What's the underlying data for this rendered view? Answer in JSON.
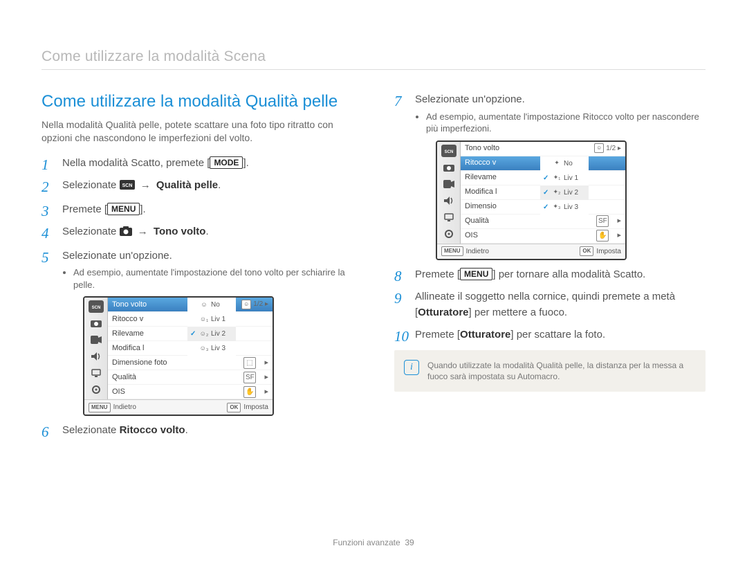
{
  "header": "Come utilizzare la modalità Scena",
  "section_title": "Come utilizzare la modalità Qualità pelle",
  "intro": "Nella modalità Qualità pelle, potete scattare una foto tipo ritratto con opzioni che nascondono le imperfezioni del volto.",
  "steps_left": {
    "s1_pre": "Nella modalità Scatto, premete [",
    "s1_btn": "MODE",
    "s1_post": "].",
    "s2_pre": "Selezionate ",
    "s2_bold": "Qualità pelle",
    "s2_post": ".",
    "s3_pre": "Premete [",
    "s3_btn": "MENU",
    "s3_post": "].",
    "s4_pre": "Selezionate ",
    "s4_bold": "Tono volto",
    "s4_post": ".",
    "s5": "Selezionate un'opzione.",
    "s5_sub": "Ad esempio, aumentate l'impostazione del tono volto per schiarire la pelle.",
    "s6_pre": "Selezionate ",
    "s6_bold": "Ritocco volto",
    "s6_post": "."
  },
  "steps_right": {
    "s7": "Selezionate un'opzione.",
    "s7_sub": "Ad esempio, aumentate l'impostazione Ritocco volto per nascondere più imperfezioni.",
    "s8_pre": "Premete [",
    "s8_btn": "MENU",
    "s8_post": "] per tornare alla modalità Scatto.",
    "s9_pre": "Allineate il soggetto nella cornice, quindi premete a metà [",
    "s9_bold": "Otturatore",
    "s9_post": "] per mettere a fuoco.",
    "s10_pre": "Premete [",
    "s10_bold": "Otturatore",
    "s10_post": "] per scattare la foto."
  },
  "menu1": {
    "rows": [
      {
        "label": "Tono volto",
        "opt_icon": "",
        "opt_text": "No",
        "selected": true
      },
      {
        "label": "Ritocco v",
        "opt_icon": "1",
        "opt_text": "Liv 1"
      },
      {
        "label": "Rilevame",
        "opt_icon": "2",
        "opt_text": "Liv 2",
        "checked": true,
        "opt_selected": true
      },
      {
        "label": "Modifica l",
        "opt_icon": "3",
        "opt_text": "Liv 3"
      },
      {
        "label": "Dimensione foto",
        "right_box": "▸"
      },
      {
        "label": "Qualità",
        "right_box": "▸"
      },
      {
        "label": "OIS",
        "right_box": "▸"
      }
    ],
    "indicator": "1/2 ▸",
    "foot_left_key": "MENU",
    "foot_left": "Indietro",
    "foot_right_key": "OK",
    "foot_right": "Imposta"
  },
  "menu2": {
    "rows": [
      {
        "label": "Tono volto",
        "right_box": ""
      },
      {
        "label": "Ritocco v",
        "opt_icon": "OFF",
        "opt_text": "No",
        "selected": true
      },
      {
        "label": "Rilevame",
        "opt_icon": "1",
        "opt_text": "Liv 1",
        "checked": true
      },
      {
        "label": "Modifica l",
        "opt_icon": "2",
        "opt_text": "Liv 2",
        "checked": true,
        "opt_selected": true
      },
      {
        "label": "Dimensio",
        "opt_icon": "3",
        "opt_text": "Liv 3",
        "checked": true
      },
      {
        "label": "Qualità",
        "right_box": "▸"
      },
      {
        "label": "OIS",
        "right_box": "▸"
      }
    ],
    "indicator": "1/2 ▸",
    "foot_left_key": "MENU",
    "foot_left": "Indietro",
    "foot_right_key": "OK",
    "foot_right": "Imposta"
  },
  "note": "Quando utilizzate la modalità Qualità pelle, la distanza per la messa a fuoco sarà impostata su Automacro.",
  "footer_label": "Funzioni avanzate",
  "footer_page": "39"
}
